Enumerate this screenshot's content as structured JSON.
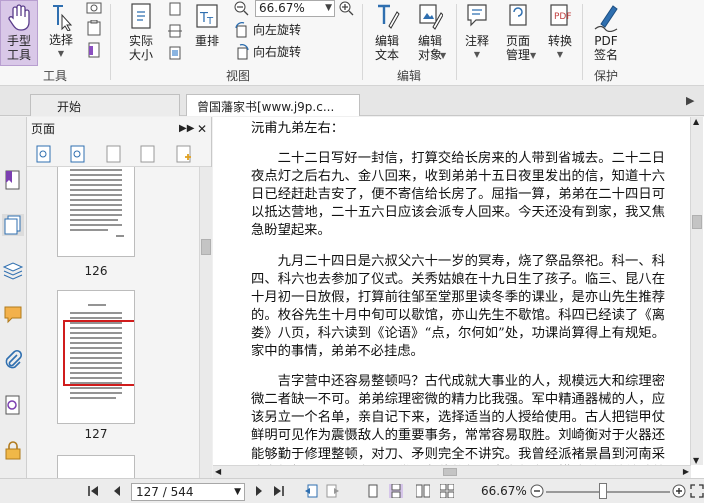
{
  "ribbon": {
    "hand_tool": "手型\n工具",
    "select": "选择",
    "actual_size": "实际\n大小",
    "reflow": "重排",
    "zoom_value": "66.67%",
    "rotate_left": "向左旋转",
    "rotate_right": "向右旋转",
    "edit_text": "编辑\n文本",
    "edit_object": "编辑\n对象",
    "comment": "注释",
    "page_manage": "页面\n管理",
    "convert": "转换",
    "pdf_sign": "PDF\n签名",
    "group_tools": "工具",
    "group_view": "视图",
    "group_edit": "编辑",
    "group_protect": "保护"
  },
  "tabs": [
    {
      "label": "开始"
    },
    {
      "label": "曾国藩家书[www.j9p.c..."
    }
  ],
  "panel": {
    "title": "页面",
    "thumbs": [
      {
        "label": "126"
      },
      {
        "label": "127"
      }
    ]
  },
  "document": {
    "salutation": "沅甫九弟左右：",
    "paragraphs": [
      "二十二日写好一封信，打算交给长房来的人带到省城去。二十二日夜点灯之后右九、金八回来，收到弟弟十五日夜里发出的信，知道十六日已经赶赴吉安了，便不寄信给长房了。屈指一算，弟弟在二十四日可以抵达营地，二十五六日应该会派专人回来。今天还没有到家，我又焦急盼望起来。",
      "九月二十四日是六叔父六十一岁的冥寿，烧了祭品祭祀。科一、科四、科六也去参加了仪式。关秀姑娘在十九日生了孩子。临三、昆八在十月初一日放假，打算前往邹至堂那里读冬季的课业，是亦山先生推荐的。枚谷先生十月中旬可以歇馆，亦山先生不歇馆。科四已经读了《离娄》八页，科六读到《论语》“点，尔何如”处，功课尚算得上有规矩。家中的事情，弟弟不必挂虑。",
      "吉字营中还容易整顿吗？古代成就大事业的人，规模远大和综理密微二者缺一不可。弟弟综理密微的精力比我强。军中精通器械的人，应该另立一个名单，亲自记下来，选择适当的人授给使用。古人把铠甲仗鲜明可见作为震慑敌人的重要事务，常常容易取胜。刘崎衡对于火器还能够勤于修理整顿，对刀、矛则完全不讲究。我曾经派褚景昌到河南采购白蜡杆子，又置办腰刀赏赐各位将领，大家颇为爱惜珍重。弟弟试着留心于这样的事，也是综理密微的一个方面。至于规模宜大，弟弟也"
    ]
  },
  "status": {
    "page_indicator": "127 / 544",
    "zoom": "66.67%"
  }
}
